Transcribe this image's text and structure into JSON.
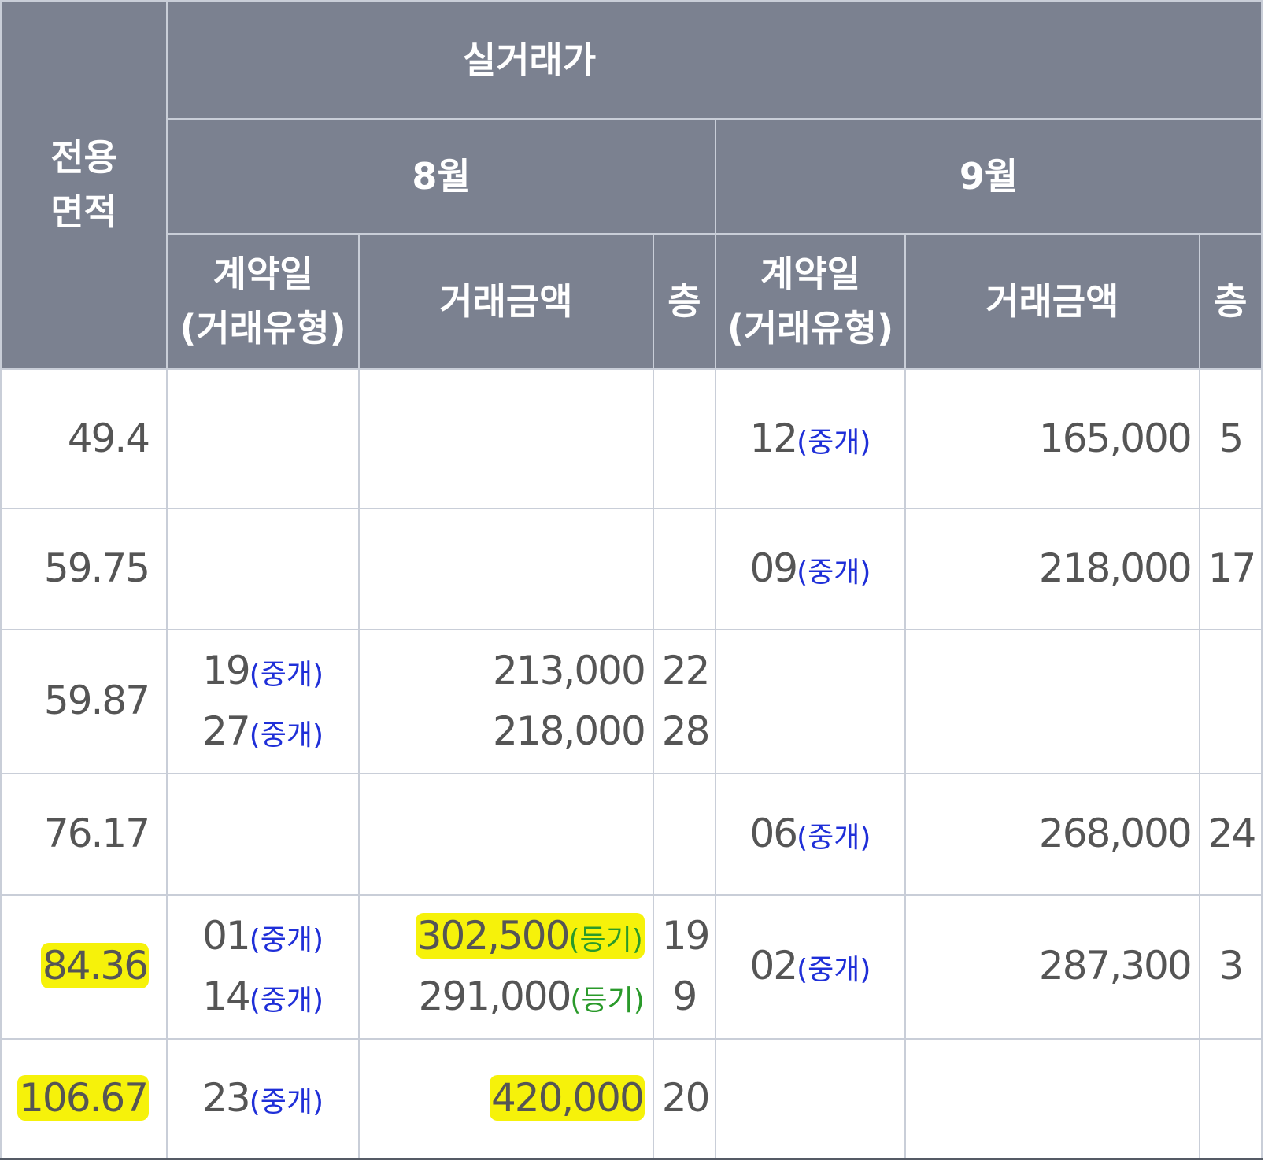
{
  "header": {
    "area_label_1": "전용",
    "area_label_2": "면적",
    "real_price": "실거래가",
    "month_aug": "8월",
    "month_sep": "9월",
    "contract_day": "계약일",
    "deal_type": "(거래유형)",
    "amount": "거래금액",
    "floor": "층"
  },
  "rows": [
    {
      "area": "49.4",
      "sep": {
        "day": "12",
        "type": "(중개)",
        "amount": "165,000",
        "floor": "5"
      }
    },
    {
      "area": "59.75",
      "sep": {
        "day": "09",
        "type": "(중개)",
        "amount": "218,000",
        "floor": "17"
      }
    },
    {
      "area": "59.87",
      "aug": [
        {
          "day": "19",
          "type": "(중개)",
          "amount": "213,000",
          "floor": "22"
        },
        {
          "day": "27",
          "type": "(중개)",
          "amount": "218,000",
          "floor": "28"
        }
      ]
    },
    {
      "area": "76.17",
      "sep": {
        "day": "06",
        "type": "(중개)",
        "amount": "268,000",
        "floor": "24"
      }
    },
    {
      "area": "84.36",
      "aug": [
        {
          "day": "01",
          "type": "(중개)",
          "amount": "302,500",
          "reg": "(등기)",
          "floor": "19"
        },
        {
          "day": "14",
          "type": "(중개)",
          "amount": "291,000",
          "reg": "(등기)",
          "floor": "9"
        }
      ],
      "sep": {
        "day": "02",
        "type": "(중개)",
        "amount": "287,300",
        "floor": "3"
      }
    },
    {
      "area": "106.67",
      "aug": [
        {
          "day": "23",
          "type": "(중개)",
          "amount": "420,000",
          "floor": "20"
        }
      ]
    }
  ],
  "colors": {
    "header_bg": "#7b8190",
    "type_text": "#1f2fd8",
    "reg_text": "#2a9a2a",
    "highlight": "#f6f20a"
  }
}
